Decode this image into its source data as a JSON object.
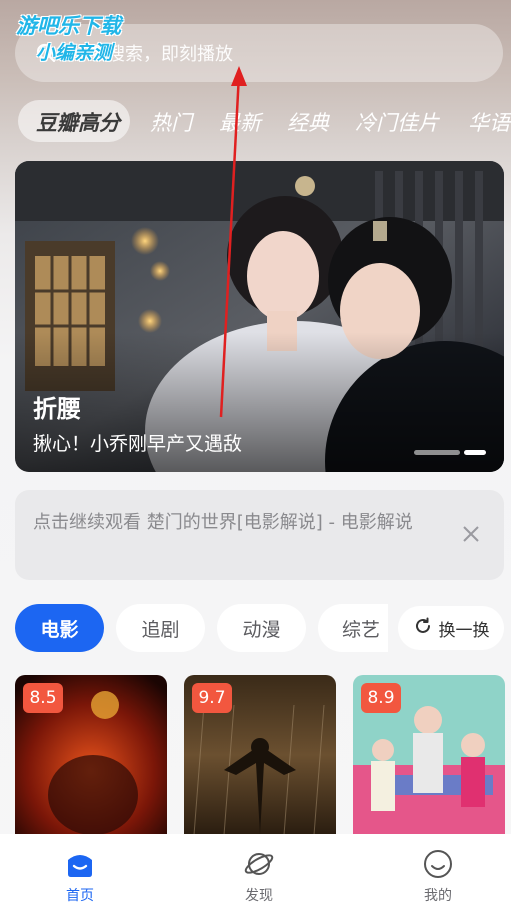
{
  "watermark": {
    "line1": "游吧乐下载",
    "line2": "小编亲测"
  },
  "search": {
    "placeholder": "片名搜索，即刻播放",
    "icon": "search-icon"
  },
  "categories": [
    {
      "label": "豆瓣高分",
      "active": true
    },
    {
      "label": "热门"
    },
    {
      "label": "最新"
    },
    {
      "label": "经典"
    },
    {
      "label": "冷门佳片"
    },
    {
      "label": "华语"
    }
  ],
  "banner": {
    "title": "折腰",
    "subtitle": "揪心！小乔刚早产又遇敌",
    "carousel_active_index": 1
  },
  "continue_watching": {
    "text": "点击继续观看 楚门的世界[电影解说] - 电影解说",
    "close_icon": "close-icon"
  },
  "content_tabs": [
    {
      "label": "电影",
      "active": true
    },
    {
      "label": "追剧"
    },
    {
      "label": "动漫"
    },
    {
      "label": "综艺"
    }
  ],
  "refresh": {
    "label": "换一换",
    "icon": "refresh-icon"
  },
  "posters": [
    {
      "score": "8.5"
    },
    {
      "score": "9.7"
    },
    {
      "score": "8.9"
    }
  ],
  "bottom_nav": [
    {
      "label": "首页",
      "icon": "home-icon",
      "active": true
    },
    {
      "label": "发现",
      "icon": "planet-icon"
    },
    {
      "label": "我的",
      "icon": "smile-icon"
    }
  ],
  "colors": {
    "accent": "#1c66f2",
    "score_badge": "#f2573f",
    "annotation_arrow": "#e02020"
  }
}
